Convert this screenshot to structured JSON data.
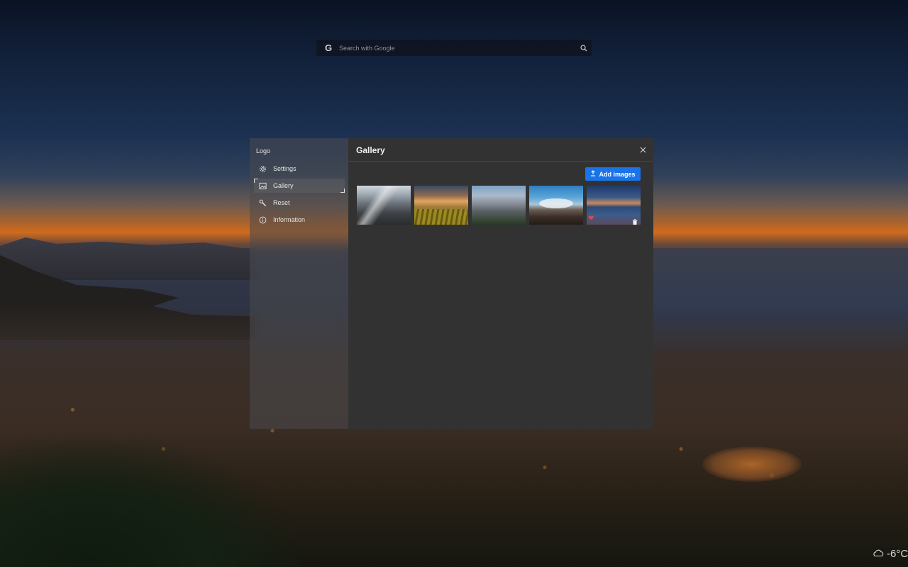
{
  "search": {
    "engine_icon": "google-g-icon",
    "engine_letter": "G",
    "placeholder": "Search with Google",
    "icon": "search-icon"
  },
  "sidebar": {
    "logo_label": "Logo",
    "items": [
      {
        "label": "Settings",
        "icon": "gear-icon",
        "active": false
      },
      {
        "label": "Gallery",
        "icon": "image-icon",
        "active": true
      },
      {
        "label": "Reset",
        "icon": "wrench-icon",
        "active": false
      },
      {
        "label": "Information",
        "icon": "info-icon",
        "active": false
      }
    ]
  },
  "gallery": {
    "title": "Gallery",
    "close_icon": "close-icon",
    "add_button_label": "Add images",
    "add_button_icon": "upload-icon",
    "accent_color": "#1a73e8",
    "thumbnails": [
      {
        "subject": "snowy mountain ridge"
      },
      {
        "subject": "vineyard at sunset"
      },
      {
        "subject": "mountain valley with clouds"
      },
      {
        "subject": "volcano with cloud cap"
      },
      {
        "subject": "coastline at dusk",
        "favorite": true,
        "favorite_icon": "heart-icon",
        "delete_icon": "trash-icon"
      }
    ]
  },
  "weather": {
    "icon": "cloud-icon",
    "temperature": "-6°C"
  }
}
